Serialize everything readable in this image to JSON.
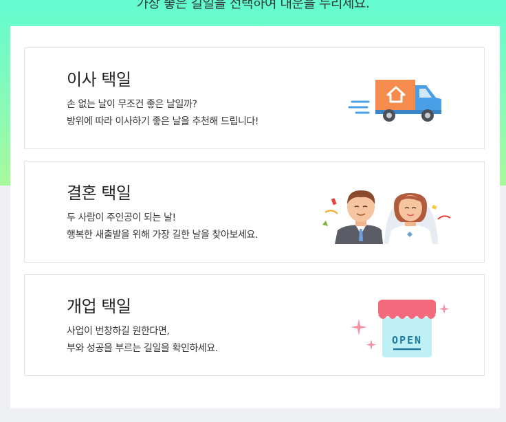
{
  "hero": {
    "subtitle": "가장 좋은 길일을 선택하여 대운을 누리세요."
  },
  "cards": [
    {
      "title": "이사 택일",
      "desc": [
        "손 없는 날이 무조건 좋은 날일까?",
        "방위에 따라 이사하기 좋은 날을 추천해 드립니다!"
      ],
      "icon": "moving-truck-icon"
    },
    {
      "title": "결혼 택일",
      "desc": [
        "두 사람이 주인공이 되는 날!",
        "행복한 새출발을 위해 가장 길한 날을 찾아보세요."
      ],
      "icon": "wedding-couple-icon"
    },
    {
      "title": "개업 택일",
      "desc": [
        "사업이 번창하길 원한다면,",
        "부와 성공을 부르는 길일을 확인하세요."
      ],
      "icon": "open-store-icon",
      "icon_text": "OPEN"
    }
  ],
  "colors": {
    "hero_top": "#63fbd0",
    "hero_bottom": "#a8f99a",
    "truck_body": "#f58b4c",
    "truck_cab": "#4aa0e6",
    "store_awning": "#f36a7c",
    "store_body": "#bff0f5",
    "sparkle": "#f58fa3"
  }
}
